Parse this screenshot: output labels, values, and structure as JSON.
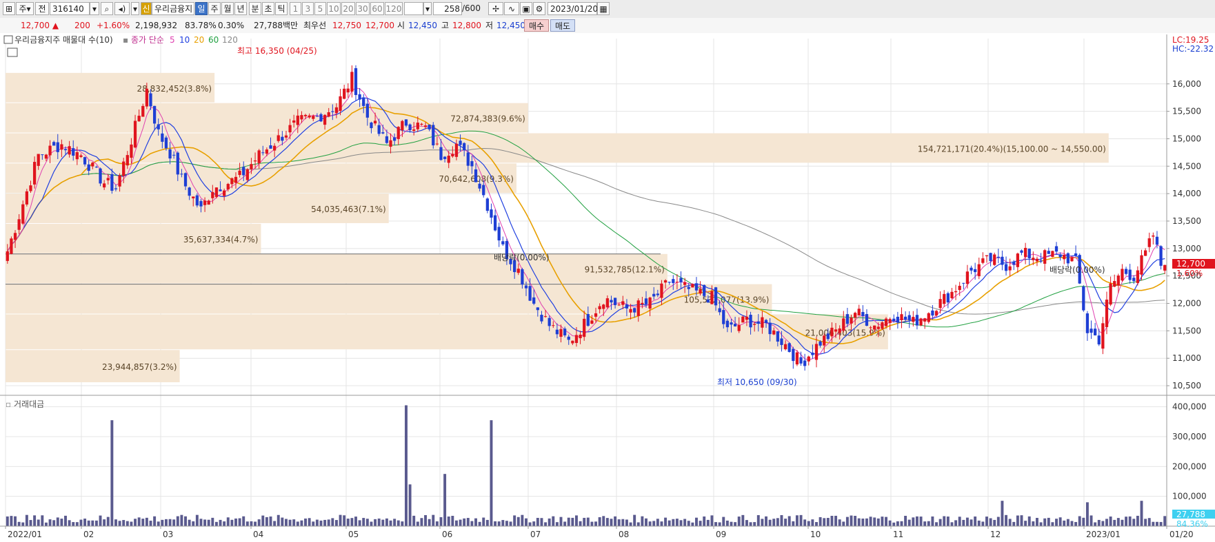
{
  "toolbar": {
    "period_sel": "주",
    "view_label": "전",
    "code": "316140",
    "name": "우리금융지",
    "name_badge": "신",
    "periods": [
      "일",
      "주",
      "월",
      "년"
    ],
    "intraday": [
      "분",
      "초",
      "틱"
    ],
    "nums": [
      "1",
      "3",
      "5",
      "10",
      "20",
      "30",
      "60",
      "120"
    ],
    "count": "258",
    "count_total": "/600",
    "date": "2023/01/20"
  },
  "infobar": {
    "price": "12,700",
    "change": "200",
    "change_pct": "+1.60%",
    "volume": "2,198,932",
    "ratio1": "83.78%",
    "ratio2": "0.30%",
    "amount": "27,788백만",
    "best_label": "최우선",
    "ask": "12,750",
    "bid": "12,700",
    "open_label": "시",
    "open": "12,450",
    "high_label": "고",
    "high": "12,800",
    "low_label": "저",
    "low": "12,450",
    "buy": "매수",
    "sell": "매도"
  },
  "colors": {
    "up": "#e0141e",
    "down": "#1f3fd4",
    "ma5": "#e040b0",
    "ma10": "#2040e0",
    "ma20": "#e8a000",
    "ma60": "#20a040",
    "ma120": "#888888",
    "profile": "#f5e6d3",
    "volume": "#5a5a8e"
  },
  "chart_data": {
    "type": "candlestick",
    "title": "우리금융지주 매물대 수(10)",
    "ma_legend": {
      "label": "종가 단순",
      "periods": [
        "5",
        "10",
        "20",
        "60",
        "120"
      ]
    },
    "y_ticks": [
      16000,
      15500,
      15000,
      14500,
      14000,
      13500,
      13000,
      12500,
      12000,
      11500,
      11000,
      10500
    ],
    "y_tick_labels": [
      "16,000",
      "15,500",
      "15,000",
      "14,500",
      "14,000",
      "13,500",
      "13,000",
      "12,500",
      "12,000",
      "11,500",
      "11,000",
      "10,500"
    ],
    "ylim": [
      10400,
      16700
    ],
    "x_labels": [
      "2022/01",
      "02",
      "03",
      "04",
      "05",
      "06",
      "07",
      "08",
      "09",
      "10",
      "11",
      "12",
      "2023/01",
      "01/20"
    ],
    "last_price_label": "12,700",
    "last_pct_label": "1.60%",
    "lc_label": "LC:19.25",
    "hc_label": "HC:-22.32",
    "annotations": {
      "high": "최고 16,350 (04/25)",
      "low": "최저 10,650 (09/30)",
      "div1": "배당락(0.00%)",
      "div2": "배당락(0.00%)"
    },
    "volume_profile": [
      {
        "label": "23,944,857(3.2%)",
        "from": 10550,
        "to": 11150,
        "width": 0.15
      },
      {
        "label": "21,006,403(15.9%)",
        "from": 11150,
        "to": 11800,
        "width": 0.76
      },
      {
        "label": "105,532,077(13.9%)",
        "from": 11800,
        "to": 12350,
        "width": 0.66
      },
      {
        "label": "91,532,785(12.1%)",
        "from": 12350,
        "to": 12900,
        "width": 0.57
      },
      {
        "label": "35,637,334(4.7%)",
        "from": 12900,
        "to": 13450,
        "width": 0.22
      },
      {
        "label": "54,035,463(7.1%)",
        "from": 13450,
        "to": 14000,
        "width": 0.33
      },
      {
        "label": "70,642,608(9.3%)",
        "from": 14000,
        "to": 14550,
        "width": 0.44
      },
      {
        "label": "154,721,171(20.4%)(15,100.00 ~ 14,550.00)",
        "from": 14550,
        "to": 15100,
        "width": 0.95
      },
      {
        "label": "72,874,383(9.6%)",
        "from": 15100,
        "to": 15650,
        "width": 0.45
      },
      {
        "label": "28,832,452(3.8%)",
        "from": 15650,
        "to": 16200,
        "width": 0.18
      }
    ],
    "volume_panel": {
      "title": "거래대금",
      "y_ticks": [
        400000,
        300000,
        200000,
        100000
      ],
      "y_tick_labels": [
        "400,000",
        "300,000",
        "200,000",
        "100,000"
      ],
      "ylim": [
        0,
        420000
      ],
      "last_value_label": "27,788",
      "last_pct_label": "84.36%"
    },
    "anchors": [
      {
        "i": 0,
        "c": 12950
      },
      {
        "i": 3,
        "c": 13600
      },
      {
        "i": 8,
        "c": 14700
      },
      {
        "i": 14,
        "c": 14900
      },
      {
        "i": 19,
        "c": 14700
      },
      {
        "i": 25,
        "c": 14200
      },
      {
        "i": 28,
        "c": 14100
      },
      {
        "i": 33,
        "c": 15200
      },
      {
        "i": 36,
        "c": 15900
      },
      {
        "i": 39,
        "c": 15100
      },
      {
        "i": 42,
        "c": 14750
      },
      {
        "i": 45,
        "c": 14250
      },
      {
        "i": 50,
        "c": 13700
      },
      {
        "i": 53,
        "c": 14100
      },
      {
        "i": 57,
        "c": 14200
      },
      {
        "i": 60,
        "c": 14300
      },
      {
        "i": 65,
        "c": 14700
      },
      {
        "i": 70,
        "c": 15000
      },
      {
        "i": 75,
        "c": 15300
      },
      {
        "i": 80,
        "c": 15400
      },
      {
        "i": 85,
        "c": 15600
      },
      {
        "i": 89,
        "c": 16100
      },
      {
        "i": 93,
        "c": 15400
      },
      {
        "i": 98,
        "c": 14900
      },
      {
        "i": 103,
        "c": 15300
      },
      {
        "i": 108,
        "c": 15200
      },
      {
        "i": 112,
        "c": 14700
      },
      {
        "i": 116,
        "c": 14900
      },
      {
        "i": 120,
        "c": 14500
      },
      {
        "i": 124,
        "c": 13800
      },
      {
        "i": 128,
        "c": 13000
      },
      {
        "i": 132,
        "c": 12600
      },
      {
        "i": 136,
        "c": 12000
      },
      {
        "i": 140,
        "c": 11600
      },
      {
        "i": 145,
        "c": 11300
      },
      {
        "i": 150,
        "c": 11700
      },
      {
        "i": 154,
        "c": 12100
      },
      {
        "i": 160,
        "c": 11900
      },
      {
        "i": 166,
        "c": 12000
      },
      {
        "i": 171,
        "c": 12400
      },
      {
        "i": 176,
        "c": 12250
      },
      {
        "i": 182,
        "c": 12100
      },
      {
        "i": 186,
        "c": 11500
      },
      {
        "i": 191,
        "c": 11700
      },
      {
        "i": 196,
        "c": 11600
      },
      {
        "i": 201,
        "c": 11250
      },
      {
        "i": 205,
        "c": 10900
      },
      {
        "i": 210,
        "c": 11300
      },
      {
        "i": 214,
        "c": 11500
      },
      {
        "i": 219,
        "c": 11850
      },
      {
        "i": 224,
        "c": 11600
      },
      {
        "i": 229,
        "c": 11800
      },
      {
        "i": 234,
        "c": 11650
      },
      {
        "i": 239,
        "c": 11900
      },
      {
        "i": 244,
        "c": 12200
      },
      {
        "i": 249,
        "c": 12600
      },
      {
        "i": 254,
        "c": 12800
      },
      {
        "i": 258,
        "c": 12700
      },
      {
        "i": 262,
        "c": 12900
      },
      {
        "i": 267,
        "c": 12850
      },
      {
        "i": 272,
        "c": 12900
      },
      {
        "i": 276,
        "c": 12750
      },
      {
        "i": 279,
        "c": 11500
      },
      {
        "i": 282,
        "c": 11350
      },
      {
        "i": 285,
        "c": 12300
      },
      {
        "i": 288,
        "c": 12600
      },
      {
        "i": 291,
        "c": 12500
      },
      {
        "i": 294,
        "c": 12900
      },
      {
        "i": 296,
        "c": 13250
      },
      {
        "i": 298,
        "c": 12700
      },
      {
        "i": 299,
        "c": 12700
      }
    ],
    "volume_spikes": [
      {
        "i": 27,
        "v": 355000
      },
      {
        "i": 103,
        "v": 405000
      },
      {
        "i": 104,
        "v": 140000
      },
      {
        "i": 113,
        "v": 175000
      },
      {
        "i": 125,
        "v": 355000
      },
      {
        "i": 257,
        "v": 85000
      },
      {
        "i": 279,
        "v": 80000
      },
      {
        "i": 293,
        "v": 85000
      }
    ]
  }
}
